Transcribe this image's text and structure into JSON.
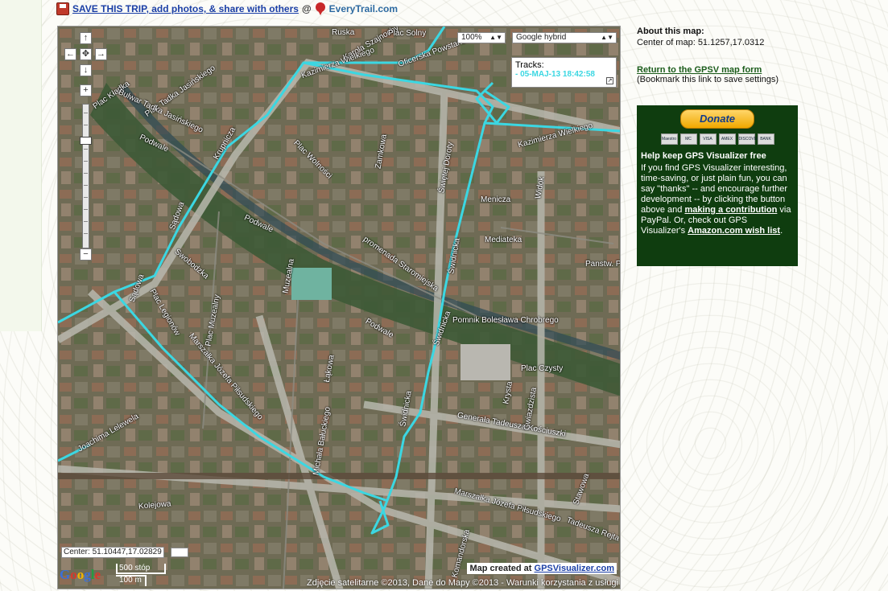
{
  "topbar": {
    "save_link": "SAVE THIS TRIP, add photos, & share with others",
    "at": "@",
    "everytrail": "EveryTrail.com"
  },
  "map": {
    "zoom_select": "100%",
    "maptype_select": "Google hybrid",
    "tracks_title": "Tracks:",
    "track_item": "- 05-MAJ-13 18:42:58",
    "track_color": "#3bd7e2",
    "center_readout": "Center: 51.10447,17.02829",
    "scale_ft": "500 stóp",
    "scale_m": "100 m",
    "google_logo": "Google",
    "credit_prefix": "Map created at",
    "credit_link": "GPSVisualizer.com",
    "copyright": "Zdjęcie satelitarne ©2013, Dane do Mapy ©2013 - Warunki korzystania z usługi",
    "pan_up": "↑",
    "pan_left": "←",
    "pan_right": "→",
    "pan_down": "↓",
    "pan_center": "✥",
    "zoom_in": "+",
    "zoom_out": "−",
    "streets": [
      "Karola Szajnochy",
      "Oficerska Powstańców",
      "Kazimierza Wielkiego",
      "Kazimierza Wielkiego",
      "Plac Solny",
      "Ruska",
      "Podwale",
      "Podwale",
      "Podwale",
      "Krupnicza",
      "Plac Wolności",
      "Zamkowa",
      "Świętej Doroty",
      "Menicza",
      "Mediateka",
      "Widok",
      "Sądowa",
      "Sądowa",
      "Swobodzka",
      "Muzealna",
      "promenada Staromiejska",
      "Świdnicka",
      "Świdnicka",
      "Świdnicka",
      "Pomnik Bolesława Chrobrego",
      "Plac Czysty",
      "Generała Tadeusza Kościuszki",
      "Marszałka Józefa Piłsudskiego",
      "Marszałka Józefa Piłsudskiego",
      "Michała Bałuckiego",
      "Łąkowa",
      "Plac Muzealny",
      "Plac Legionów",
      "Joachima Lelewela",
      "Kolejowa",
      "Stawowa",
      "Tadeusza Rejta",
      "Komandorska",
      "Gwiazdzista",
      "Krysta",
      "Plac Tadka Jasińskiego",
      "Plac Kładka",
      "Bulwar Tadka Jasińskiego",
      "Panstw. Poznań Miejska Rat. Gas"
    ]
  },
  "sidebar": {
    "about_title": "About this map:",
    "center_text": "Center of map: 51.1257,17.0312",
    "return_link": "Return to the GPSV map form",
    "bookmark_note": "(Bookmark this link to save settings)"
  },
  "donate": {
    "button": "Donate",
    "cards": [
      "Maestro",
      "MC",
      "VISA",
      "AMEX",
      "DISCOVER",
      "BANK"
    ],
    "heading": "Help keep GPS Visualizer free",
    "text1": "If you find GPS Visualizer interesting, time-saving, or just plain fun, you can say \"thanks\" -- and encourage further development -- by clicking the button above and",
    "link1": "making a contribution",
    "text2": "via PayPal. Or, check out GPS Visualizer's",
    "link2": "Amazon.com wish list",
    "text3": "."
  }
}
